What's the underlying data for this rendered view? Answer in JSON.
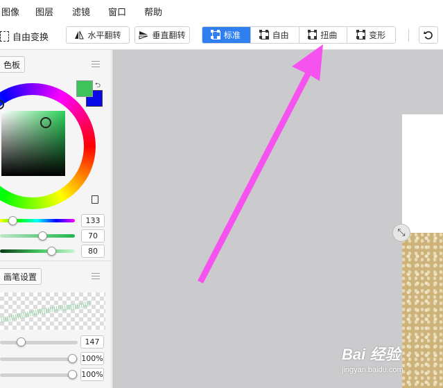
{
  "menu": [
    "图像",
    "图层",
    "滤镜",
    "窗口",
    "帮助"
  ],
  "toolbar": {
    "free_transform": "自由变换",
    "flip_h": "水平翻转",
    "flip_v": "垂直翻转",
    "modes": [
      "标准",
      "自由",
      "扭曲",
      "变形"
    ],
    "active_mode": "标准"
  },
  "panel": {
    "swatch_tab": "色板",
    "brush_tab": "画笔设置",
    "foreground_color": "#3ec25a",
    "background_color": "#0a0ae8",
    "hsl": {
      "h": "133",
      "s": "70",
      "l": "80"
    },
    "brush": {
      "size": "147",
      "opacity": "100%",
      "flow": "100%"
    }
  },
  "watermark": {
    "main": "Bai 经验",
    "sub": "jingyan.baidu.com"
  },
  "colors": {
    "accent": "#2f7ff0",
    "arrow": "#f552f0",
    "canvas_bg": "#cbcbcd"
  }
}
